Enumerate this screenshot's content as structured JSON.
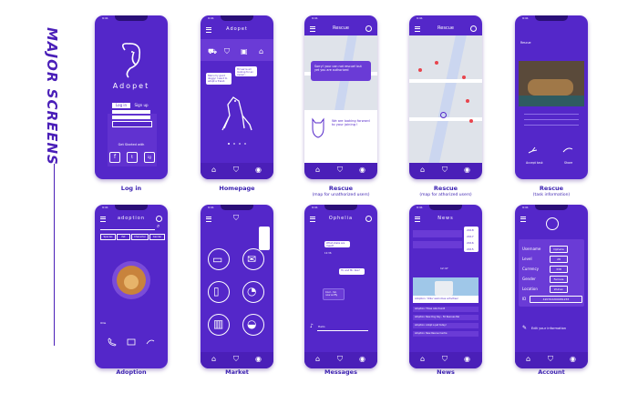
{
  "side_title": "MAJOR SCREENS",
  "status_time": "9:41",
  "colors": {
    "primary": "#5427c9",
    "dark": "#4a1fb8",
    "accent": "#e8444d",
    "caption": "#3a1fb0"
  },
  "screens": {
    "login": {
      "caption": "Log in",
      "logo_text": "Adopet",
      "tab_login": "Log in",
      "tab_signup": "Sign up",
      "connect_text": "Get Started with",
      "social": [
        "f",
        "t",
        "ig"
      ]
    },
    "homepage": {
      "caption": "Homepage",
      "title": "Adopet",
      "bubble1": "Stars my good doggy! I want to adopt a friend.",
      "bubble2": "Hi! we're all looking for an owner..."
    },
    "rescue_unauth": {
      "caption": "Rescue",
      "subcaption": "(map for unathorized users)",
      "title": "Rescue",
      "msg": "Sorry! your can not rescue! but yet you are authorized",
      "card": "We are looking forward to your joining !"
    },
    "rescue_auth": {
      "caption": "Rescue",
      "subcaption": "(map for athorized users)",
      "title": "Rescue"
    },
    "rescue_task": {
      "caption": "Rescue",
      "subcaption": "(task information)",
      "header_left": "Rescue",
      "left_action": "Accept task",
      "right_action": "Share"
    },
    "adoption": {
      "caption": "Adoption",
      "title": "adoption",
      "filters": [
        "Species",
        "Pet",
        "Character",
        "Gender"
      ],
      "actions": [
        "",
        "",
        ""
      ],
      "tag_row": "Ollie"
    },
    "market": {
      "caption": "Market",
      "items": [
        "bag",
        "mail",
        "",
        "ball",
        "",
        "bird"
      ]
    },
    "messages": {
      "caption": "Messages",
      "title": "Ophelia",
      "m1": "What shake are meet?",
      "m2": "12:36",
      "m3": "Hi, and Mr. Aks?",
      "m4": "Cool - Sin now sniffy",
      "input": "Hello"
    },
    "news": {
      "caption": "News",
      "title": "News",
      "years": [
        "2018",
        "2017",
        "2016",
        "2015"
      ],
      "time": "12:47",
      "story": "Adoption: 'Ollie' welcomes activities!",
      "rows": [
        "Adoption: Three cats found!",
        "Adoption: New Dog Day - 50 Rescues Bel",
        "Adoption: Adopt a pet today!",
        "Adoption: New Rescue Centre"
      ]
    },
    "account": {
      "caption": "Account",
      "fields": [
        {
          "label": "Username",
          "value": "Ophelia"
        },
        {
          "label": "Level",
          "value": "28"
        },
        {
          "label": "Currency",
          "value": "338"
        },
        {
          "label": "Gender",
          "value": "Female"
        },
        {
          "label": "Location",
          "value": "Wuhan"
        },
        {
          "label": "ID",
          "value": "420702200081233"
        }
      ],
      "edit": "Edit your information"
    }
  }
}
